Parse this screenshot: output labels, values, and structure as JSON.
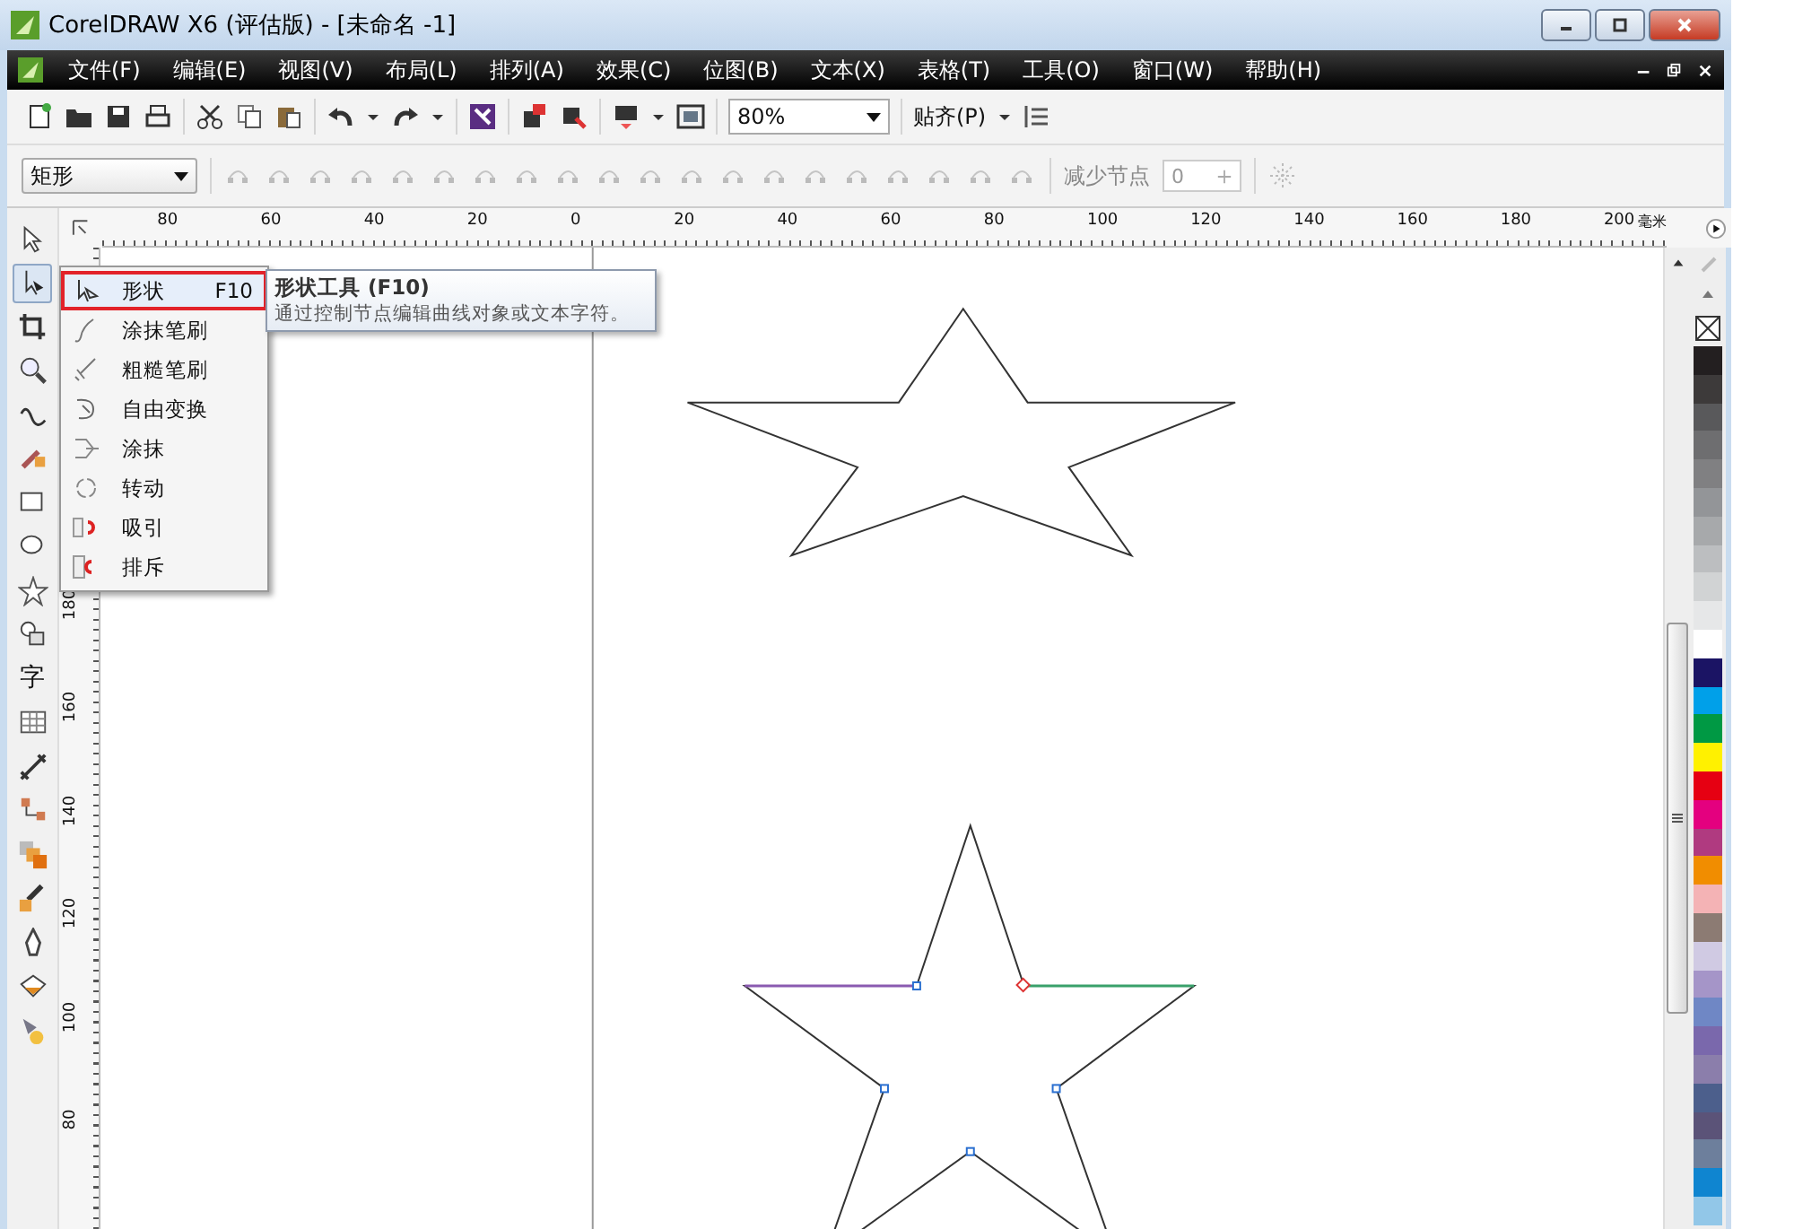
{
  "window": {
    "title": "CorelDRAW X6 (评估版) - [未命名 -1]"
  },
  "menu": [
    "文件(F)",
    "编辑(E)",
    "视图(V)",
    "布局(L)",
    "排列(A)",
    "效果(C)",
    "位图(B)",
    "文本(X)",
    "表格(T)",
    "工具(O)",
    "窗口(W)",
    "帮助(H)"
  ],
  "toolbar": {
    "zoom": "80%",
    "snap": "贴齐(P)"
  },
  "property_bar": {
    "object_type": "矩形",
    "reduce_nodes_label": "减少节点",
    "reduce_nodes_value": "0"
  },
  "ruler": {
    "unit": "毫米",
    "horizontal": [
      "80",
      "60",
      "40",
      "20",
      "0",
      "20",
      "40",
      "60",
      "80",
      "100",
      "120",
      "140",
      "160",
      "180",
      "200"
    ],
    "vertical": [
      "180",
      "160",
      "140",
      "120",
      "100",
      "80"
    ]
  },
  "toolbox": [
    {
      "kind": "pick",
      "selected": false
    },
    {
      "kind": "shape",
      "selected": true
    },
    {
      "kind": "crop",
      "selected": false
    },
    {
      "kind": "zoom",
      "selected": false
    },
    {
      "kind": "curve",
      "selected": false
    },
    {
      "kind": "smart",
      "selected": false
    },
    {
      "kind": "rectangle",
      "selected": false
    },
    {
      "kind": "ellipse",
      "selected": false
    },
    {
      "kind": "star",
      "selected": false
    },
    {
      "kind": "shapes",
      "selected": false
    },
    {
      "kind": "text",
      "label": "字",
      "selected": false
    },
    {
      "kind": "table",
      "selected": false
    },
    {
      "kind": "dimension",
      "selected": false
    },
    {
      "kind": "connector",
      "selected": false
    },
    {
      "kind": "blend",
      "selected": false
    },
    {
      "kind": "eyedropper",
      "selected": false
    },
    {
      "kind": "outline",
      "selected": false
    },
    {
      "kind": "fill",
      "selected": false
    },
    {
      "kind": "interactive",
      "selected": false
    }
  ],
  "flyout": [
    {
      "label": "形状",
      "shortcut": "F10",
      "selected": true
    },
    {
      "label": "涂抹笔刷",
      "selected": false
    },
    {
      "label": "粗糙笔刷",
      "selected": false
    },
    {
      "label": "自由变换",
      "selected": false
    },
    {
      "label": "涂抹",
      "selected": false
    },
    {
      "label": "转动",
      "selected": false
    },
    {
      "label": "吸引",
      "selected": false
    },
    {
      "label": "排斥",
      "selected": false
    }
  ],
  "tooltip": {
    "title": "形状工具 (F10)",
    "description": "通过控制节点编辑曲线对象或文本字符。"
  },
  "palette": [
    {
      "color": "#231f20"
    },
    {
      "color": "#3d3a3a"
    },
    {
      "color": "#59595b"
    },
    {
      "color": "#6e6e70"
    },
    {
      "color": "#808082"
    },
    {
      "color": "#939598"
    },
    {
      "color": "#a7a9ab"
    },
    {
      "color": "#bcbec0"
    },
    {
      "color": "#d1d3d4"
    },
    {
      "color": "#e6e7e8"
    },
    {
      "color": "#ffffff"
    },
    {
      "color": "#1b1464"
    },
    {
      "color": "#00a0e9"
    },
    {
      "color": "#009944"
    },
    {
      "color": "#fff100"
    },
    {
      "color": "#e60012"
    },
    {
      "color": "#e4007f"
    },
    {
      "color": "#b03a80"
    },
    {
      "color": "#f18d00"
    },
    {
      "color": "#f4b3b5"
    },
    {
      "color": "#8c7b73"
    },
    {
      "color": "#d0cae3"
    },
    {
      "color": "#a595c8"
    },
    {
      "color": "#6f87c5"
    },
    {
      "color": "#7a68ac"
    },
    {
      "color": "#8b7eab"
    },
    {
      "color": "#4c5f8c"
    },
    {
      "color": "#5b5378"
    },
    {
      "color": "#6d7f9c"
    },
    {
      "color": "#0f85d0"
    },
    {
      "color": "#92c7e8"
    }
  ]
}
